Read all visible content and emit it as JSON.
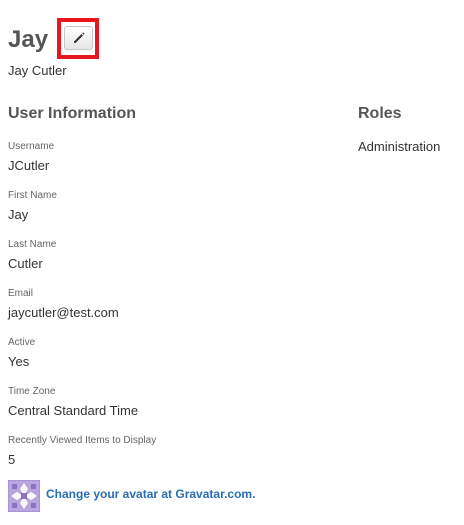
{
  "header": {
    "title": "Jay",
    "edit_icon": "pencil-icon",
    "highlight_color": "#e8161d",
    "subtitle": "Jay Cutler"
  },
  "user_info": {
    "heading": "User Information",
    "fields": [
      {
        "label": "Username",
        "value": "JCutler"
      },
      {
        "label": "First Name",
        "value": "Jay"
      },
      {
        "label": "Last Name",
        "value": "Cutler"
      },
      {
        "label": "Email",
        "value": "jaycutler@test.com"
      },
      {
        "label": "Active",
        "value": "Yes"
      },
      {
        "label": "Time Zone",
        "value": "Central Standard Time"
      },
      {
        "label": "Recently Viewed Items to Display",
        "value": "5"
      }
    ]
  },
  "roles": {
    "heading": "Roles",
    "items": [
      "Administration"
    ]
  },
  "gravatar": {
    "icon": "gravatar-avatar-icon",
    "link_text": "Change your avatar at Gravatar.com.",
    "link_color": "#2a6fb3"
  }
}
